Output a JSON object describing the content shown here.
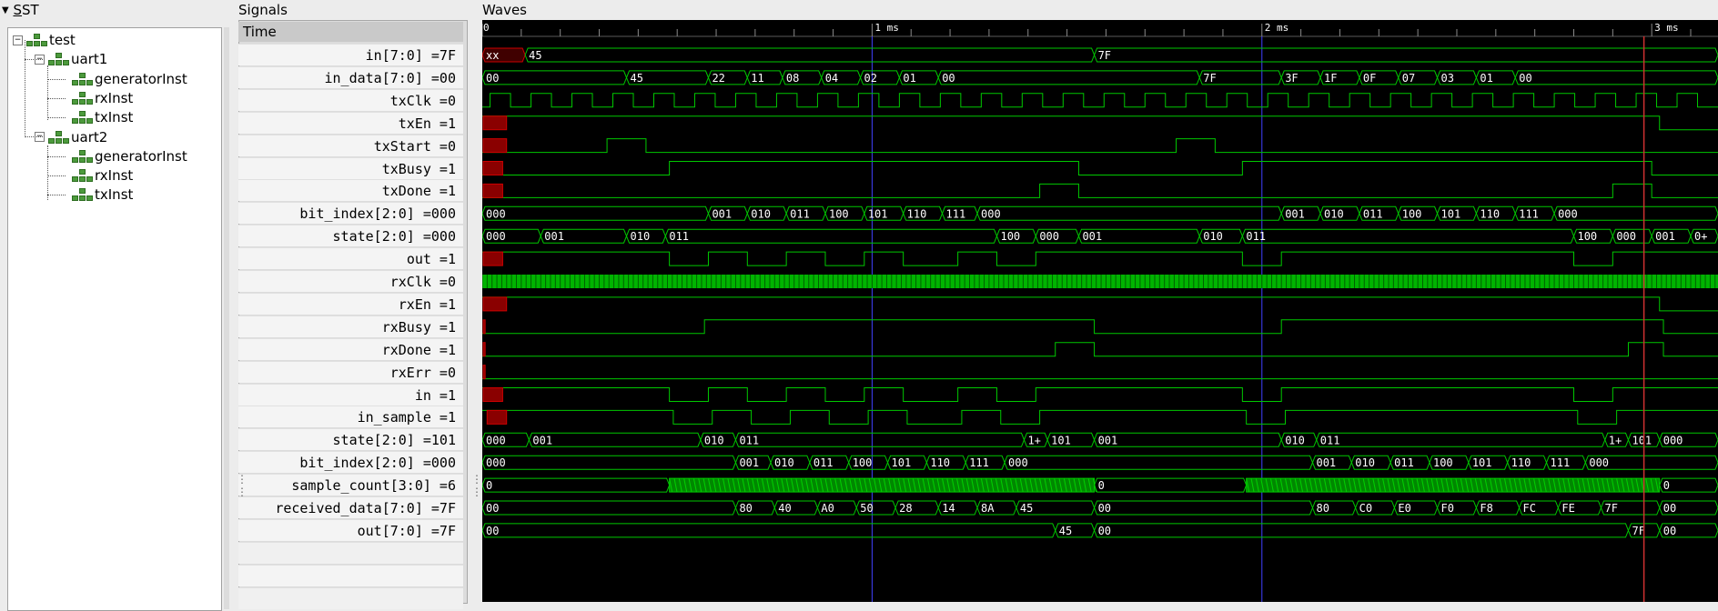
{
  "colors": {
    "wave": "#00c800",
    "bus_fill": "#008800",
    "unknown": "#cc0000",
    "cursor": "#d03030",
    "marker": "#4040ff",
    "bg": "#000000"
  },
  "sst": {
    "title_prefix": "",
    "title_hot": "S",
    "title_rest": "ST",
    "tree": [
      {
        "label": "test",
        "level": 0,
        "expanded": true
      },
      {
        "label": "uart1",
        "level": 1,
        "expanded": true
      },
      {
        "label": "generatorInst",
        "level": 2
      },
      {
        "label": "rxInst",
        "level": 2
      },
      {
        "label": "txInst",
        "level": 2
      },
      {
        "label": "uart2",
        "level": 1,
        "expanded": true
      },
      {
        "label": "generatorInst",
        "level": 2
      },
      {
        "label": "rxInst",
        "level": 2
      },
      {
        "label": "txInst",
        "level": 2
      }
    ]
  },
  "signals_panel": {
    "title": "Signals",
    "time_label": "Time",
    "rows": [
      "in[7:0] =7F",
      "in_data[7:0] =00",
      "txClk =0",
      "txEn =1",
      "txStart =0",
      "txBusy =1",
      "txDone =1",
      "bit_index[2:0] =000",
      "state[2:0] =000",
      "out =1",
      "rxClk =0",
      "rxEn =1",
      "rxBusy =1",
      "rxDone =1",
      "rxErr =0",
      "in =1",
      "in_sample =1",
      "state[2:0] =101",
      "bit_index[2:0] =000",
      "sample_count[3:0] =6",
      "received_data[7:0] =7F",
      "out[7:0] =7F"
    ]
  },
  "waves_panel": {
    "title": "Waves",
    "time_axis": {
      "start_label": "0",
      "major_labels": [
        "1 ms",
        "2 ms",
        "3 ms"
      ],
      "end_ms": 3.17
    },
    "cursor_ms": 2.98,
    "marker_ms": [
      1,
      2
    ]
  },
  "wave_data": [
    {
      "kind": "bus",
      "segs": [
        [
          0,
          0.11,
          "xx",
          1
        ],
        [
          0.11,
          1.57,
          "45"
        ],
        [
          1.57,
          3.17,
          "7F"
        ]
      ]
    },
    {
      "kind": "bus",
      "segs": [
        [
          0,
          0.37,
          "00"
        ],
        [
          0.37,
          0.58,
          "45"
        ],
        [
          0.58,
          0.68,
          "22"
        ],
        [
          0.68,
          0.77,
          "11"
        ],
        [
          0.77,
          0.87,
          "08"
        ],
        [
          0.87,
          0.97,
          "04"
        ],
        [
          0.97,
          1.07,
          "02"
        ],
        [
          1.07,
          1.17,
          "01"
        ],
        [
          1.17,
          1.84,
          "00"
        ],
        [
          1.84,
          2.05,
          "7F"
        ],
        [
          2.05,
          2.15,
          "3F"
        ],
        [
          2.15,
          2.25,
          "1F"
        ],
        [
          2.25,
          2.35,
          "0F"
        ],
        [
          2.35,
          2.45,
          "07"
        ],
        [
          2.45,
          2.55,
          "03"
        ],
        [
          2.55,
          2.65,
          "01"
        ],
        [
          2.65,
          3.17,
          "00"
        ]
      ]
    },
    {
      "kind": "clock",
      "period": 0.105,
      "offset": 0.02
    },
    {
      "kind": "bit",
      "init": 1,
      "red": [
        0,
        0.06
      ],
      "edges": [
        [
          0.12,
          1
        ],
        [
          3.02,
          0
        ]
      ]
    },
    {
      "kind": "bit",
      "init": 0,
      "red": [
        0,
        0.06
      ],
      "edges": [
        [
          0.32,
          1
        ],
        [
          0.42,
          0
        ],
        [
          1.78,
          1
        ],
        [
          1.88,
          0
        ]
      ]
    },
    {
      "kind": "bit",
      "init": 0,
      "red": [
        0,
        0.05
      ],
      "edges": [
        [
          0.48,
          1
        ],
        [
          1.53,
          0
        ],
        [
          1.95,
          1
        ],
        [
          3.0,
          0
        ]
      ]
    },
    {
      "kind": "bit",
      "init": 0,
      "red": [
        0,
        0.05
      ],
      "edges": [
        [
          1.43,
          1
        ],
        [
          1.53,
          0
        ],
        [
          2.9,
          1
        ],
        [
          3.0,
          0
        ]
      ]
    },
    {
      "kind": "bus",
      "segs": [
        [
          0,
          0.58,
          "000"
        ],
        [
          0.58,
          0.68,
          "001"
        ],
        [
          0.68,
          0.78,
          "010"
        ],
        [
          0.78,
          0.88,
          "011"
        ],
        [
          0.88,
          0.98,
          "100"
        ],
        [
          0.98,
          1.08,
          "101"
        ],
        [
          1.08,
          1.18,
          "110"
        ],
        [
          1.18,
          1.27,
          "111"
        ],
        [
          1.27,
          2.05,
          "000"
        ],
        [
          2.05,
          2.15,
          "001"
        ],
        [
          2.15,
          2.25,
          "010"
        ],
        [
          2.25,
          2.35,
          "011"
        ],
        [
          2.35,
          2.45,
          "100"
        ],
        [
          2.45,
          2.55,
          "101"
        ],
        [
          2.55,
          2.65,
          "110"
        ],
        [
          2.65,
          2.75,
          "111"
        ],
        [
          2.75,
          3.17,
          "000"
        ]
      ]
    },
    {
      "kind": "bus",
      "segs": [
        [
          0,
          0.15,
          "000"
        ],
        [
          0.15,
          0.37,
          "001"
        ],
        [
          0.37,
          0.47,
          "010"
        ],
        [
          0.47,
          1.32,
          "011"
        ],
        [
          1.32,
          1.42,
          "100"
        ],
        [
          1.42,
          1.53,
          "000"
        ],
        [
          1.53,
          1.84,
          "001"
        ],
        [
          1.84,
          1.95,
          "010"
        ],
        [
          1.95,
          2.8,
          "011"
        ],
        [
          2.8,
          2.9,
          "100"
        ],
        [
          2.9,
          3.0,
          "000"
        ],
        [
          3.0,
          3.1,
          "001"
        ],
        [
          3.1,
          3.17,
          "0+"
        ]
      ]
    },
    {
      "kind": "bit",
      "init": 1,
      "red": [
        0,
        0.05
      ],
      "edges": [
        [
          0.48,
          0
        ],
        [
          0.58,
          1
        ],
        [
          0.68,
          0
        ],
        [
          0.78,
          1
        ],
        [
          0.88,
          0
        ],
        [
          0.98,
          1
        ],
        [
          1.08,
          0
        ],
        [
          1.22,
          1
        ],
        [
          1.32,
          0
        ],
        [
          1.42,
          1
        ],
        [
          1.95,
          0
        ],
        [
          2.05,
          1
        ],
        [
          2.8,
          0
        ],
        [
          2.9,
          1
        ]
      ]
    },
    {
      "kind": "fastclock",
      "period": 0.0125
    },
    {
      "kind": "bit",
      "init": 1,
      "red": [
        0,
        0.06
      ],
      "edges": [
        [
          0.12,
          1
        ],
        [
          3.02,
          0
        ]
      ]
    },
    {
      "kind": "bit",
      "init": 0,
      "red": [
        0,
        0.005
      ],
      "edges": [
        [
          0.57,
          1
        ],
        [
          1.57,
          0
        ],
        [
          2.05,
          1
        ],
        [
          3.03,
          0
        ]
      ]
    },
    {
      "kind": "bit",
      "init": 0,
      "red": [
        0,
        0.005
      ],
      "edges": [
        [
          1.47,
          1
        ],
        [
          1.57,
          0
        ],
        [
          2.94,
          1
        ],
        [
          3.03,
          0
        ]
      ]
    },
    {
      "kind": "bit",
      "init": 0,
      "red": [
        0,
        0.005
      ],
      "edges": []
    },
    {
      "kind": "bit",
      "init": 1,
      "red": [
        0,
        0.05
      ],
      "edges": [
        [
          0.48,
          0
        ],
        [
          0.58,
          1
        ],
        [
          0.68,
          0
        ],
        [
          0.78,
          1
        ],
        [
          0.88,
          0
        ],
        [
          0.98,
          1
        ],
        [
          1.08,
          0
        ],
        [
          1.22,
          1
        ],
        [
          1.32,
          0
        ],
        [
          1.42,
          1
        ],
        [
          1.95,
          0
        ],
        [
          2.05,
          1
        ],
        [
          2.8,
          0
        ],
        [
          2.9,
          1
        ]
      ]
    },
    {
      "kind": "bit",
      "init": 1,
      "red": [
        0.01,
        0.06
      ],
      "edges": [
        [
          0.49,
          0
        ],
        [
          0.59,
          1
        ],
        [
          0.69,
          0
        ],
        [
          0.79,
          1
        ],
        [
          0.89,
          0
        ],
        [
          0.99,
          1
        ],
        [
          1.09,
          0
        ],
        [
          1.23,
          1
        ],
        [
          1.33,
          0
        ],
        [
          1.43,
          1
        ],
        [
          1.96,
          0
        ],
        [
          2.06,
          1
        ],
        [
          2.81,
          0
        ],
        [
          2.91,
          1
        ]
      ]
    },
    {
      "kind": "bus",
      "segs": [
        [
          0,
          0.12,
          "000"
        ],
        [
          0.12,
          0.56,
          "001"
        ],
        [
          0.56,
          0.65,
          "010"
        ],
        [
          0.65,
          1.39,
          "011"
        ],
        [
          1.39,
          1.45,
          "1+"
        ],
        [
          1.45,
          1.57,
          "101"
        ],
        [
          1.57,
          2.05,
          "001"
        ],
        [
          2.05,
          2.14,
          "010"
        ],
        [
          2.14,
          2.88,
          "011"
        ],
        [
          2.88,
          2.94,
          "1+"
        ],
        [
          2.94,
          3.02,
          "101"
        ],
        [
          3.02,
          3.17,
          "000"
        ]
      ]
    },
    {
      "kind": "bus",
      "segs": [
        [
          0,
          0.65,
          "000"
        ],
        [
          0.65,
          0.74,
          "001"
        ],
        [
          0.74,
          0.84,
          "010"
        ],
        [
          0.84,
          0.94,
          "011"
        ],
        [
          0.94,
          1.04,
          "100"
        ],
        [
          1.04,
          1.14,
          "101"
        ],
        [
          1.14,
          1.24,
          "110"
        ],
        [
          1.24,
          1.34,
          "111"
        ],
        [
          1.34,
          2.13,
          "000"
        ],
        [
          2.13,
          2.23,
          "001"
        ],
        [
          2.23,
          2.33,
          "010"
        ],
        [
          2.33,
          2.43,
          "011"
        ],
        [
          2.43,
          2.53,
          "100"
        ],
        [
          2.53,
          2.63,
          "101"
        ],
        [
          2.63,
          2.73,
          "110"
        ],
        [
          2.73,
          2.83,
          "111"
        ],
        [
          2.83,
          3.17,
          "000"
        ]
      ]
    },
    {
      "kind": "busfast",
      "segs": [
        [
          0,
          0.48,
          "0"
        ],
        [
          1.57,
          1.96,
          "0"
        ],
        [
          3.02,
          3.17,
          "0"
        ]
      ],
      "fast": [
        [
          0.48,
          1.57
        ],
        [
          1.96,
          3.02
        ]
      ]
    },
    {
      "kind": "bus",
      "segs": [
        [
          0,
          0.65,
          "00"
        ],
        [
          0.65,
          0.75,
          "80"
        ],
        [
          0.75,
          0.86,
          "40"
        ],
        [
          0.86,
          0.96,
          "A0"
        ],
        [
          0.96,
          1.06,
          "50"
        ],
        [
          1.06,
          1.17,
          "28"
        ],
        [
          1.17,
          1.27,
          "14"
        ],
        [
          1.27,
          1.37,
          "8A"
        ],
        [
          1.37,
          1.57,
          "45"
        ],
        [
          1.57,
          2.13,
          "00"
        ],
        [
          2.13,
          2.24,
          "80"
        ],
        [
          2.24,
          2.34,
          "C0"
        ],
        [
          2.34,
          2.45,
          "E0"
        ],
        [
          2.45,
          2.55,
          "F0"
        ],
        [
          2.55,
          2.66,
          "F8"
        ],
        [
          2.66,
          2.76,
          "FC"
        ],
        [
          2.76,
          2.87,
          "FE"
        ],
        [
          2.87,
          3.02,
          "7F"
        ],
        [
          3.02,
          3.17,
          "00"
        ]
      ]
    },
    {
      "kind": "bus",
      "segs": [
        [
          0,
          1.47,
          "00"
        ],
        [
          1.47,
          1.57,
          "45"
        ],
        [
          1.57,
          2.94,
          "00"
        ],
        [
          2.94,
          3.02,
          "7F"
        ],
        [
          3.02,
          3.17,
          "00"
        ]
      ]
    }
  ]
}
